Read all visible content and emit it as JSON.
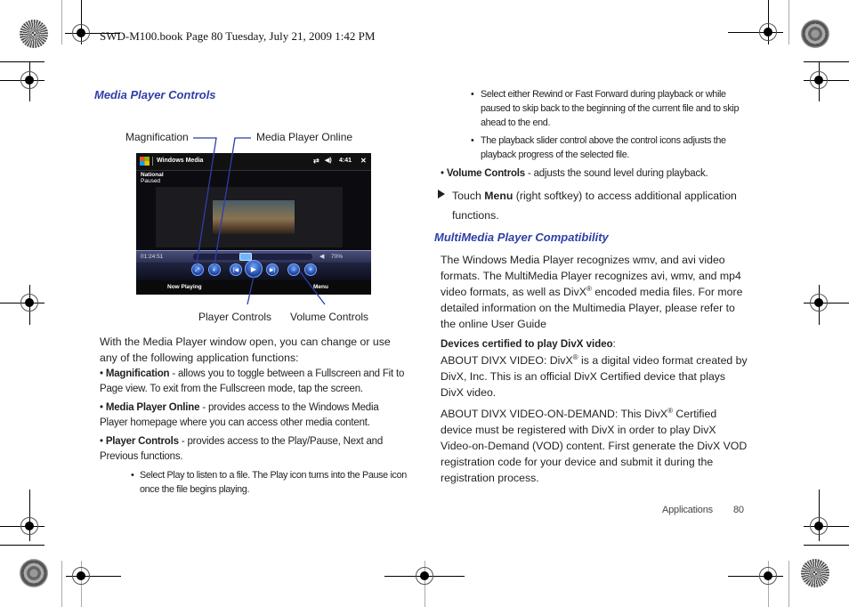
{
  "header": {
    "print_line": "SWD-M100.book  Page 80  Tuesday, July 21, 2009  1:42 PM"
  },
  "left": {
    "section_title": "Media Player Controls",
    "figure": {
      "callouts": {
        "magnification": "Magnification",
        "media_player_online": "Media Player Online",
        "player_controls": "Player Controls",
        "volume_controls": "Volume Controls"
      },
      "device": {
        "app_title": "Windows Media",
        "clock": "4:41",
        "close_glyph": "✕",
        "sync_glyph": "⇄",
        "volume_glyph": "◀)",
        "track_name": "National",
        "status": "Paused",
        "elapsed": "01:24:51",
        "volume_percent": "70%",
        "seek_position": 0.43,
        "buttons": {
          "magnification": "⤢",
          "online": "◐",
          "previous": "|◀",
          "play": "▶",
          "next": "▶|",
          "volume_down": "−",
          "volume_up": "+"
        },
        "left_softkey": "Now Playing",
        "right_softkey": "Menu"
      }
    },
    "intro": "With the Media Player window open, you can change or use any of the following application functions:",
    "bullets": [
      {
        "term": "Magnification",
        "text": " - allows you to toggle between a Fullscreen and Fit to Page view. To exit from the Fullscreen mode, tap the screen."
      },
      {
        "term": "Media Player Online",
        "text": " - provides access to the Windows Media Player homepage where you can access other media content."
      },
      {
        "term": "Player Controls",
        "text": " - provides access to the Play/Pause, Next and Previous functions."
      }
    ],
    "sub_bullets": [
      "Select Play to listen to a file. The Play icon turns into the Pause icon once the file begins playing."
    ]
  },
  "right": {
    "sub_bullets": [
      "Select either Rewind or Fast Forward during playback or while paused to skip back to the beginning of the current file and to skip ahead to the end.",
      "The playback slider control above the control icons adjusts the playback progress of the selected file."
    ],
    "volume_bullet": {
      "term": "Volume Controls",
      "text": " - adjusts the sound level during playback."
    },
    "step": {
      "pre": "Touch ",
      "term": "Menu",
      "post": " (right softkey) to access additional application functions."
    },
    "section_title": "MultiMedia Player Compatibility",
    "para1": {
      "a": "The Windows Media Player recognizes wmv, and avi video formats. The MultiMedia Player recognizes avi, wmv, and mp4 video formats, as well as DivX",
      "reg": "®",
      "b": " encoded media files. For more detailed information on the Multimedia Player, please refer to the online User Guide"
    },
    "devices_heading": "Devices certified to play DivX video",
    "devices_colon": ":",
    "para2": {
      "a": "ABOUT DIVX VIDEO: DivX",
      "reg": "®",
      "b": " is a digital video format created by DivX, Inc. This is an official DivX Certified device that plays DivX video."
    },
    "para3": {
      "a": "ABOUT DIVX VIDEO-ON-DEMAND: This DivX",
      "reg": "®",
      "b": " Certified device must be registered with DivX in order to play DivX Video-on-Demand (VOD) content. First generate the DivX VOD registration code for your device and submit it during the registration process."
    }
  },
  "footer": {
    "section": "Applications",
    "page_number": "80"
  }
}
